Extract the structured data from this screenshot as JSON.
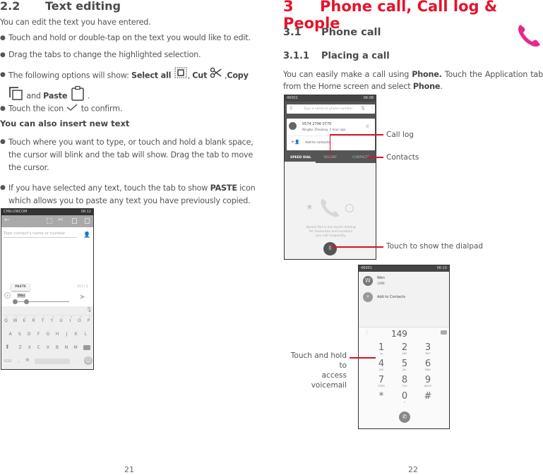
{
  "left_page": {
    "section_number": "2.2",
    "section_title": "Text editing",
    "intro": "You can edit the text you have entered.",
    "bullets": [
      "Touch and hold or double-tap on the text you would like to edit.",
      "Drag the tabs to change the highlighted selection."
    ],
    "options_bullet": {
      "prefix": "The following options will show: ",
      "select_all": "Select all",
      "comma1": ",",
      "cut": "Cut",
      "comma2": ",",
      "copy": "Copy",
      "and": "and",
      "paste": "Paste",
      "period": "."
    },
    "confirm_bullet": {
      "prefix": "Touch the icon",
      "suffix": "to confirm."
    },
    "subheading": "You can also insert new text",
    "insert_bullets": [
      "Touch where you want to type, or touch and hold a blank space, the cursor will blink and the tab will show. Drag the tab to move the cursor."
    ],
    "paste_bullet": {
      "prefix": "If you have selected any text, touch the tab to show ",
      "paste": "PASTE",
      "suffix": " icon which allows you to paste any text you have previously copied."
    },
    "screenshot": {
      "carrier": "CHN-UNICOM",
      "time": "08:12",
      "to_placeholder": "Type contact's name or number",
      "paste_popup": "PASTE",
      "char_count": "157 / 1",
      "typed_text": "Wei",
      "keyboard_rows": [
        [
          "Q",
          "W",
          "E",
          "R",
          "T",
          "Y",
          "U",
          "I",
          "O",
          "P"
        ],
        [
          "A",
          "S",
          "D",
          "F",
          "G",
          "H",
          "J",
          "K",
          "L"
        ],
        [
          "Z",
          "X",
          "C",
          "V",
          "B",
          "N",
          "M"
        ]
      ],
      "number_hints": [
        "1",
        "2",
        "3",
        "4",
        "5",
        "6",
        "7",
        "8",
        "9",
        "0"
      ],
      "symbols_key": "?123",
      "comma_key": ",",
      "period_key": "."
    },
    "page_number": "21"
  },
  "right_page": {
    "chapter_number": "3",
    "chapter_title": "Phone call, Call log & People",
    "section_number": "3.1",
    "section_title": "Phone call",
    "subsection_number": "3.1.1",
    "subsection_title": "Placing a call",
    "body": {
      "part1": "You can easily make a call using ",
      "phone1": "Phone.",
      "part2": " Touch the Application tab from the Home screen and select ",
      "phone2": "Phone",
      "part3": "."
    },
    "screenshot1": {
      "carrier": "46001",
      "time": "06:08",
      "search_placeholder": "Type a name or phone number",
      "recent_number": "0574 2796 0770",
      "recent_detail": "Ningbo, Zhejiang, 1 hour ago",
      "add_to_contacts": "Add to contacts",
      "tabs": [
        "SPEED DIAL",
        "RECENT",
        "CONTACTS"
      ],
      "empty_message": [
        "Speed dial is one touch dialling",
        "for favourites and numbers",
        "you call frequently."
      ]
    },
    "callouts": {
      "call_log": "Call log",
      "contacts": "Contacts",
      "dialpad": "Touch to show the dialpad",
      "voicemail_line1": "Touch and hold to",
      "voicemail_line2": "access voicemail"
    },
    "screenshot2": {
      "carrier": "46001",
      "time": "06:10",
      "contact_initial": "W",
      "contact_name": "Wen",
      "contact_number": "1496",
      "add_to_contacts": "Add to Contacts",
      "dialed": "149",
      "keys": [
        {
          "n": "1",
          "s": "oo"
        },
        {
          "n": "2",
          "s": "ABC"
        },
        {
          "n": "3",
          "s": "DEF"
        },
        {
          "n": "4",
          "s": "GHI"
        },
        {
          "n": "5",
          "s": "JKL"
        },
        {
          "n": "6",
          "s": "MNO"
        },
        {
          "n": "7",
          "s": "PQRS"
        },
        {
          "n": "8",
          "s": "TUV"
        },
        {
          "n": "9",
          "s": "WXYZ"
        },
        {
          "n": "*",
          "s": ""
        },
        {
          "n": "0",
          "s": "+"
        },
        {
          "n": "#",
          "s": ""
        }
      ]
    },
    "page_number": "22"
  },
  "colors": {
    "accent_red": "#e6132b",
    "callout_red": "#d8112a",
    "phone_icon_pink": "#e8298a"
  }
}
